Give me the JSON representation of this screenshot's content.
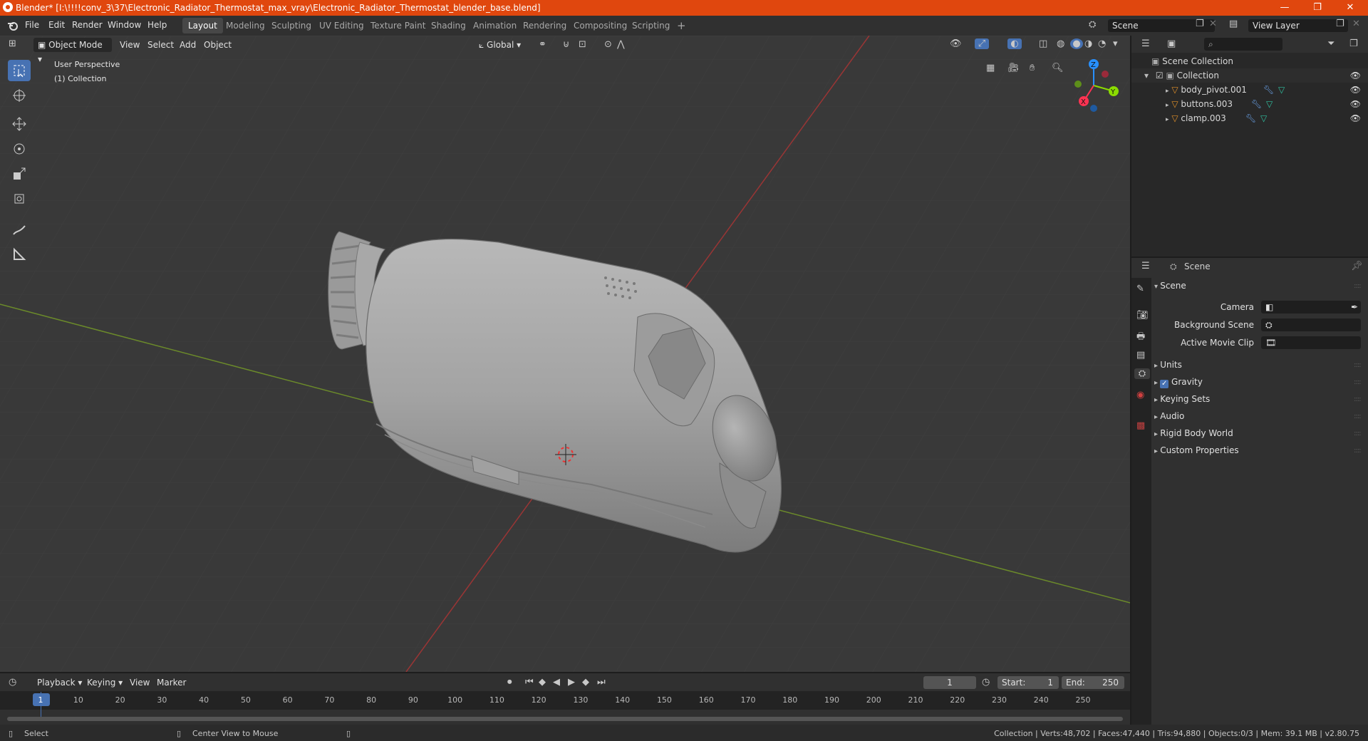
{
  "window": {
    "title": "Blender* [I:\\!!!!conv_3\\37\\Electronic_Radiator_Thermostat_max_vray\\Electronic_Radiator_Thermostat_blender_base.blend]",
    "minimize": "—",
    "maximize": "❐",
    "close": "✕"
  },
  "menu": {
    "file": "File",
    "edit": "Edit",
    "render": "Render",
    "window": "Window",
    "help": "Help"
  },
  "workspaces": [
    "Layout",
    "Modeling",
    "Sculpting",
    "UV Editing",
    "Texture Paint",
    "Shading",
    "Animation",
    "Rendering",
    "Compositing",
    "Scripting"
  ],
  "add_workspace": "+",
  "scene_field": "Scene",
  "view_layer_field": "View Layer",
  "viewport_header": {
    "mode": "Object Mode",
    "view": "View",
    "select": "Select",
    "add": "Add",
    "object": "Object",
    "transform_orientation": "Global"
  },
  "viewport": {
    "perspective_label": "User Perspective",
    "collection_label": "(1) Collection",
    "gizmo": {
      "x": "X",
      "y": "Y",
      "z": "Z"
    }
  },
  "outliner": {
    "search_placeholder": "",
    "scene_collection": "Scene Collection",
    "collection": "Collection",
    "objects": [
      "body_pivot.001",
      "buttons.003",
      "clamp.003"
    ]
  },
  "properties": {
    "header": "Scene",
    "section": "Scene",
    "camera_label": "Camera",
    "background_scene_label": "Background Scene",
    "active_movie_clip_label": "Active Movie Clip",
    "subsections": [
      "Units",
      "Gravity",
      "Keying Sets",
      "Audio",
      "Rigid Body World",
      "Custom Properties"
    ],
    "gravity_checked": true
  },
  "timeline": {
    "playback": "Playback",
    "keying": "Keying",
    "view": "View",
    "marker": "Marker",
    "current_frame": "1",
    "start_label": "Start:",
    "start_value": "1",
    "end_label": "End:",
    "end_value": "250",
    "ticks": [
      "1",
      "10",
      "20",
      "30",
      "40",
      "50",
      "60",
      "70",
      "80",
      "90",
      "100",
      "110",
      "120",
      "130",
      "140",
      "150",
      "160",
      "170",
      "180",
      "190",
      "200",
      "210",
      "220",
      "230",
      "240",
      "250"
    ]
  },
  "status": {
    "select": "Select",
    "center_view": "Center View to Mouse",
    "stats": "Collection | Verts:48,702 | Faces:47,440 | Tris:94,880 | Objects:0/3 | Mem: 39.1 MB | v2.80.75"
  },
  "colors": {
    "accent": "#4772b3",
    "titlebar": "#e0470e",
    "x_axis": "#ff3352",
    "y_axis": "#8bdc00",
    "z_axis": "#2890ff"
  }
}
